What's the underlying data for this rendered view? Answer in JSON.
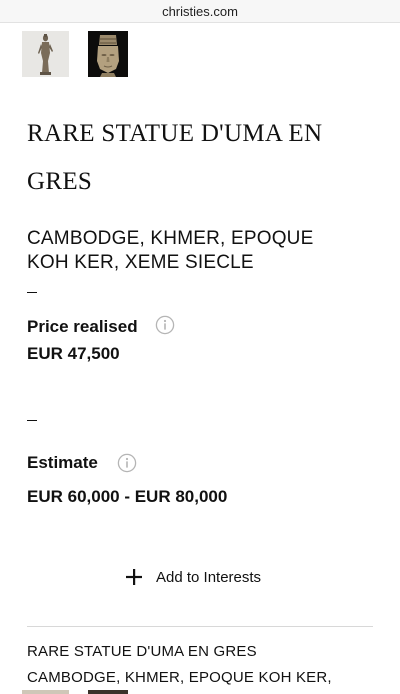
{
  "browser": {
    "url": "christies.com"
  },
  "gallery": {
    "thumbnails": [
      {
        "name": "statue full view",
        "selected": true
      },
      {
        "name": "statue head detail",
        "selected": false
      }
    ],
    "accent_color": "#d1322b"
  },
  "lot": {
    "title_line1": "RARE STATUE D'UMA EN",
    "title_line2": "GRES",
    "subtitle_line1": "CAMBODGE, KHMER, EPOQUE",
    "subtitle_line2": "KOH KER, XEME SIECLE",
    "price_realised_label": "Price realised",
    "price_realised_value": "EUR 47,500",
    "estimate_label": "Estimate",
    "estimate_value": "EUR 60,000 - EUR 80,000",
    "add_interests_label": "Add to Interests",
    "description_line1": "RARE STATUE D'UMA EN GRES",
    "description_line2": "CAMBODGE, KHMER, EPOQUE KOH KER,"
  },
  "icons": {
    "info": "info-circle-icon",
    "plus": "plus-icon"
  }
}
